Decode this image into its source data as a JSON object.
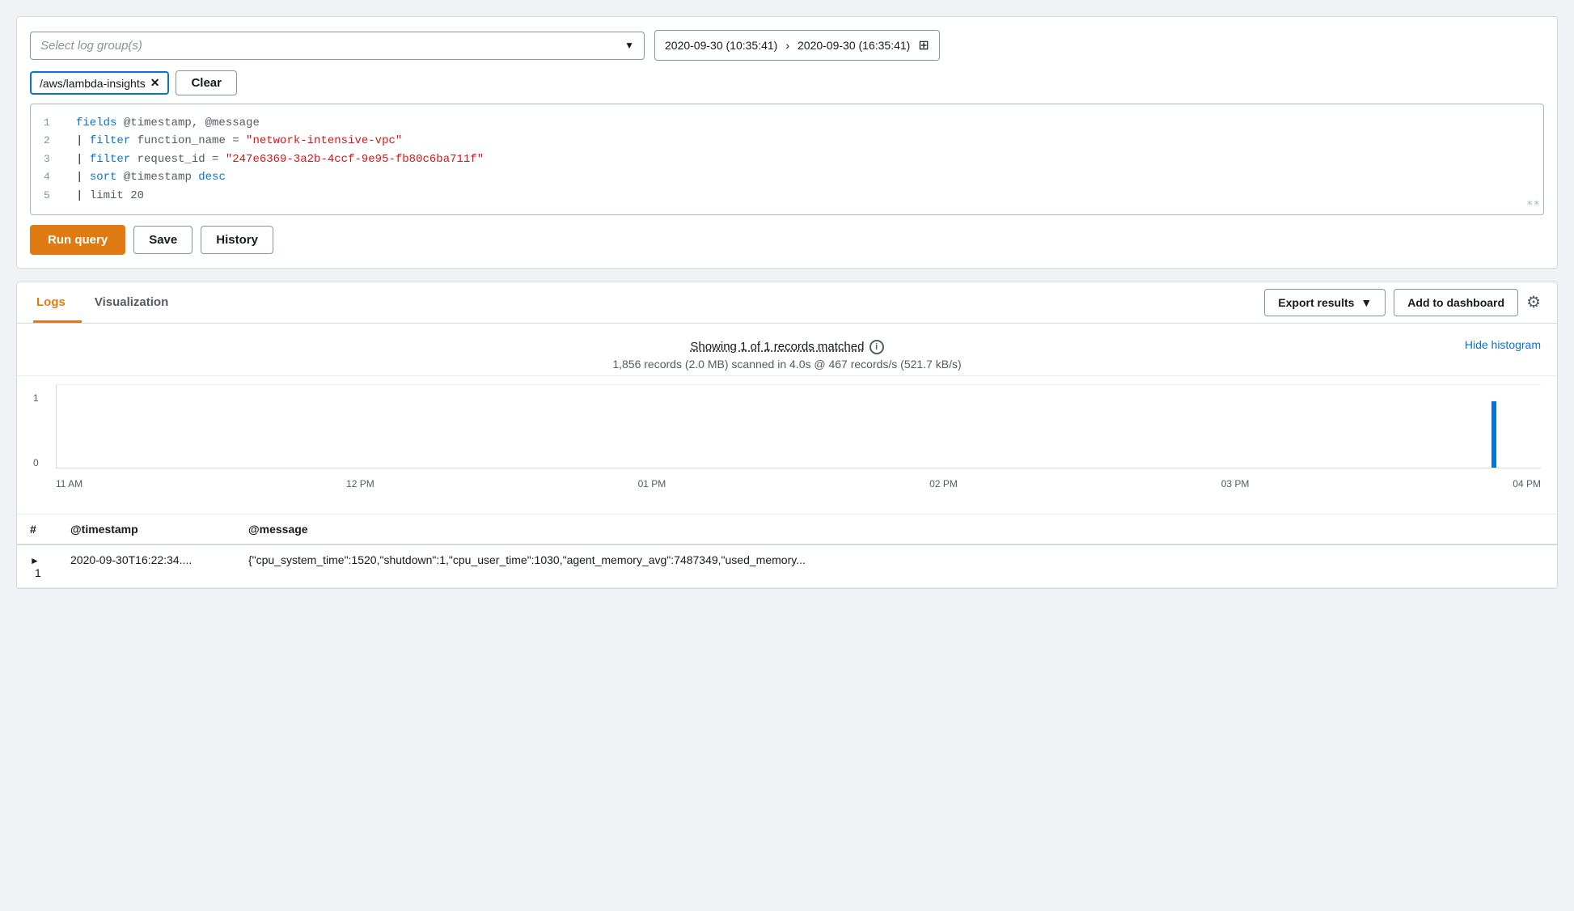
{
  "topPanel": {
    "logGroupSelect": {
      "placeholder": "Select log group(s)"
    },
    "dateRange": {
      "start": "2020-09-30 (10:35:41)",
      "end": "2020-09-30 (16:35:41)"
    },
    "tags": [
      {
        "label": "/aws/lambda-insights"
      }
    ],
    "clearLabel": "Clear",
    "codeLines": [
      {
        "num": "1",
        "content": [
          {
            "text": "fields ",
            "cls": "kw-blue"
          },
          {
            "text": "@timestamp, @message",
            "cls": "kw-gray"
          }
        ]
      },
      {
        "num": "2",
        "content": [
          {
            "text": "|  ",
            "cls": ""
          },
          {
            "text": "filter ",
            "cls": "kw-blue"
          },
          {
            "text": "function_name = ",
            "cls": "kw-gray"
          },
          {
            "text": "\"network-intensive-vpc\"",
            "cls": "kw-red"
          }
        ]
      },
      {
        "num": "3",
        "content": [
          {
            "text": "|  ",
            "cls": ""
          },
          {
            "text": "filter ",
            "cls": "kw-blue"
          },
          {
            "text": "request_id = ",
            "cls": "kw-gray"
          },
          {
            "text": "\"247e6369-3a2b-4ccf-9e95-fb80c6ba711f\"",
            "cls": "kw-red"
          }
        ]
      },
      {
        "num": "4",
        "content": [
          {
            "text": "|  ",
            "cls": ""
          },
          {
            "text": "sort ",
            "cls": "kw-blue"
          },
          {
            "text": "@timestamp ",
            "cls": "kw-gray"
          },
          {
            "text": "desc",
            "cls": "kw-blue"
          }
        ]
      },
      {
        "num": "5",
        "content": [
          {
            "text": "|  ",
            "cls": ""
          },
          {
            "text": "limit 20",
            "cls": "kw-gray"
          }
        ]
      }
    ],
    "runQueryLabel": "Run query",
    "saveLabel": "Save",
    "historyLabel": "History"
  },
  "bottomPanel": {
    "tabs": [
      {
        "label": "Logs",
        "active": true
      },
      {
        "label": "Visualization",
        "active": false
      }
    ],
    "exportResultsLabel": "Export results",
    "addToDashboardLabel": "Add to dashboard",
    "stats": {
      "showing": "Showing 1 of 1 records matched",
      "scanned": "1,856 records (2.0 MB) scanned in 4.0s @ 467 records/s (521.7 kB/s)"
    },
    "hideHistogramLabel": "Hide histogram",
    "histogram": {
      "xLabels": [
        "11 AM",
        "12 PM",
        "01 PM",
        "02 PM",
        "03 PM",
        "04 PM"
      ],
      "yLabels": [
        "1",
        "0"
      ],
      "barPosition": 0.95
    },
    "table": {
      "headers": [
        "#",
        "@timestamp",
        "@message"
      ],
      "rows": [
        {
          "num": "1",
          "timestamp": "2020-09-30T16:22:34....",
          "message": "{\"cpu_system_time\":1520,\"shutdown\":1,\"cpu_user_time\":1030,\"agent_memory_avg\":7487349,\"used_memory..."
        }
      ]
    }
  }
}
